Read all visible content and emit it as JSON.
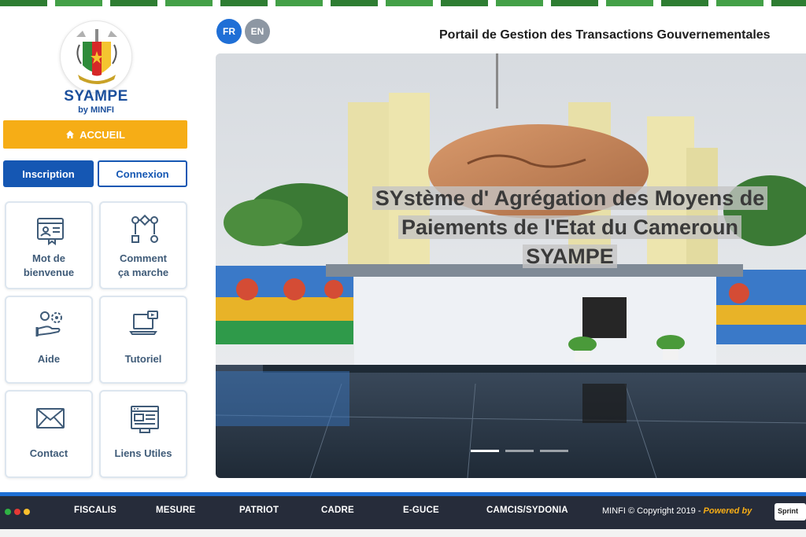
{
  "brand": {
    "name": "SYAMPE",
    "sub": "by MINFI"
  },
  "nav": {
    "accueil": "ACCUEIL",
    "inscription": "Inscription",
    "connexion": "Connexion"
  },
  "tiles": [
    {
      "l1": "Mot de",
      "l2": "bienvenue",
      "icon": "welcome-id-icon"
    },
    {
      "l1": "Comment",
      "l2": "ça marche",
      "icon": "workflow-icon"
    },
    {
      "l1": "Aide",
      "icon": "help-gears-icon"
    },
    {
      "l1": "Tutoriel",
      "icon": "tutorial-laptop-icon"
    },
    {
      "l1": "Contact",
      "icon": "envelope-icon"
    },
    {
      "l1": "Liens Utiles",
      "icon": "web-links-icon"
    }
  ],
  "header": {
    "lang_fr": "FR",
    "lang_en": "EN",
    "title": "Portail de Gestion des Transactions Gouvernementales"
  },
  "hero": {
    "line1": "SYstème d' Agrégation des Moyens de",
    "line2": "Paiements de l'Etat du Cameroun",
    "line3": "SYAMPE",
    "slides": 3,
    "active_slide": 1
  },
  "footer": {
    "links": [
      "FISCALIS",
      "MESURE",
      "PATRIOT",
      "CADRE",
      "E-GUCE",
      "CAMCIS/SYDONIA"
    ],
    "copyright": "MINFI © Copyright 2019 -",
    "powered_by": "Powered by",
    "partner": "Sprint",
    "dot_colors": [
      "#2fb344",
      "#e53935",
      "#fbc02d"
    ]
  },
  "colors": {
    "accent_orange": "#f6ad16",
    "primary_blue": "#1557b3",
    "footer_bg": "#262c3a"
  }
}
